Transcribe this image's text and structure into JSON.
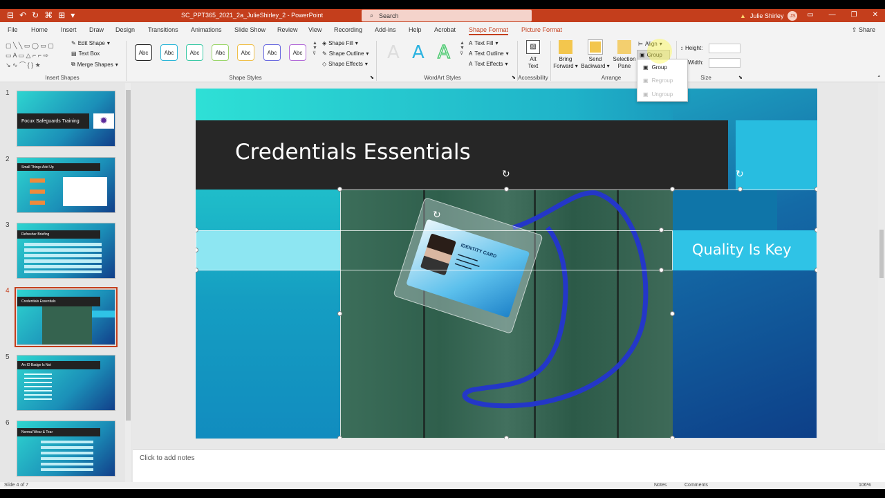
{
  "titlebar": {
    "doc_title": "SC_PPT365_2021_2a_JulieShirley_2  -  PowerPoint",
    "search_placeholder": "Search",
    "user_name": "Julie Shirley",
    "user_initials": "JS"
  },
  "tabs": [
    "File",
    "Home",
    "Insert",
    "Draw",
    "Design",
    "Transitions",
    "Animations",
    "Slide Show",
    "Review",
    "View",
    "Recording",
    "Add-ins",
    "Help",
    "Acrobat",
    "Shape Format",
    "Picture Format"
  ],
  "share_label": "Share",
  "ribbon": {
    "insert_shapes": {
      "label": "Insert Shapes",
      "edit_shape": "Edit Shape",
      "text_box": "Text Box",
      "merge_shapes": "Merge Shapes"
    },
    "shape_styles": {
      "label": "Shape Styles",
      "sample": "Abc",
      "shape_fill": "Shape Fill",
      "shape_outline": "Shape Outline",
      "shape_effects": "Shape Effects"
    },
    "wordart": {
      "label": "WordArt Styles",
      "letter": "A",
      "text_fill": "Text Fill",
      "text_outline": "Text Outline",
      "text_effects": "Text Effects"
    },
    "accessibility": {
      "label": "Accessibility",
      "alt_text_1": "Alt",
      "alt_text_2": "Text"
    },
    "arrange": {
      "label": "Arrange",
      "bring_forward_1": "Bring",
      "bring_forward_2": "Forward",
      "send_backward_1": "Send",
      "send_backward_2": "Backward",
      "selection_pane_1": "Selection",
      "selection_pane_2": "Pane",
      "align": "Align",
      "group": "Group"
    },
    "size": {
      "label": "Size",
      "height": "Height:",
      "width": "Width:"
    }
  },
  "group_menu": {
    "group": "Group",
    "regroup": "Regroup",
    "ungroup": "Ungroup"
  },
  "thumbnails": [
    {
      "num": "1",
      "title": "Focux Safeguards Training"
    },
    {
      "num": "2",
      "title": "Small Things Add Up"
    },
    {
      "num": "3",
      "title": "Refresher Briefing"
    },
    {
      "num": "4",
      "title": "Credentials Essentials"
    },
    {
      "num": "5",
      "title": "An ID Badge Is Not"
    },
    {
      "num": "6",
      "title": "Normal Wear & Tear"
    }
  ],
  "slide": {
    "title": "Credentials Essentials",
    "callout": "Quality Is Key",
    "card_heading": "IDENTITY CARD"
  },
  "notes_placeholder": "Click to add notes",
  "status": {
    "slide_counter": "Slide 4 of 7",
    "notes": "Notes",
    "comments": "Comments",
    "zoom": "106%"
  }
}
